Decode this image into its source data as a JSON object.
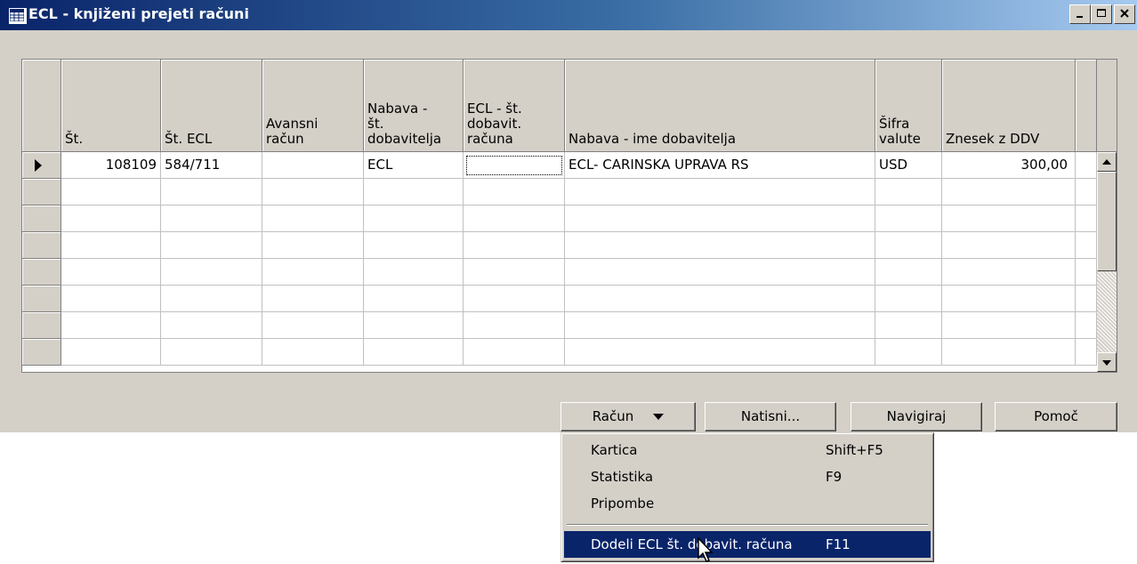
{
  "window": {
    "title": "ECL - knjiženi prejeti računi"
  },
  "table": {
    "columns": [
      "Št.",
      "Št. ECL",
      "Avansni\nračun",
      "Nabava -\nšt.\ndobavitelja",
      "ECL - št.\ndobavit.\nračuna",
      "Nabava - ime dobavitelja",
      "Šifra\nvalute",
      "Znesek z DDV"
    ],
    "rows": [
      {
        "st": "108109",
        "st_ecl": "584/711",
        "avansni": "",
        "nabava_st": "ECL",
        "ecl_st": "",
        "ime": "ECL- CARINSKA UPRAVA RS",
        "valuta": "USD",
        "znesek": "300,00"
      }
    ]
  },
  "buttons": {
    "racun": "Račun",
    "natisni": "Natisni...",
    "navigiraj": "Navigiraj",
    "pomoc": "Pomoč"
  },
  "menu": {
    "items": [
      {
        "label": "Kartica",
        "shortcut": "Shift+F5"
      },
      {
        "label": "Statistika",
        "shortcut": "F9"
      },
      {
        "label": "Pripombe",
        "shortcut": ""
      },
      {
        "label": "Dodeli ECL št. dobavit. računa",
        "shortcut": "F11"
      }
    ]
  },
  "colors": {
    "titlebar": "#0a246a",
    "face": "#d4d0c8",
    "highlight": "#0a246a"
  }
}
